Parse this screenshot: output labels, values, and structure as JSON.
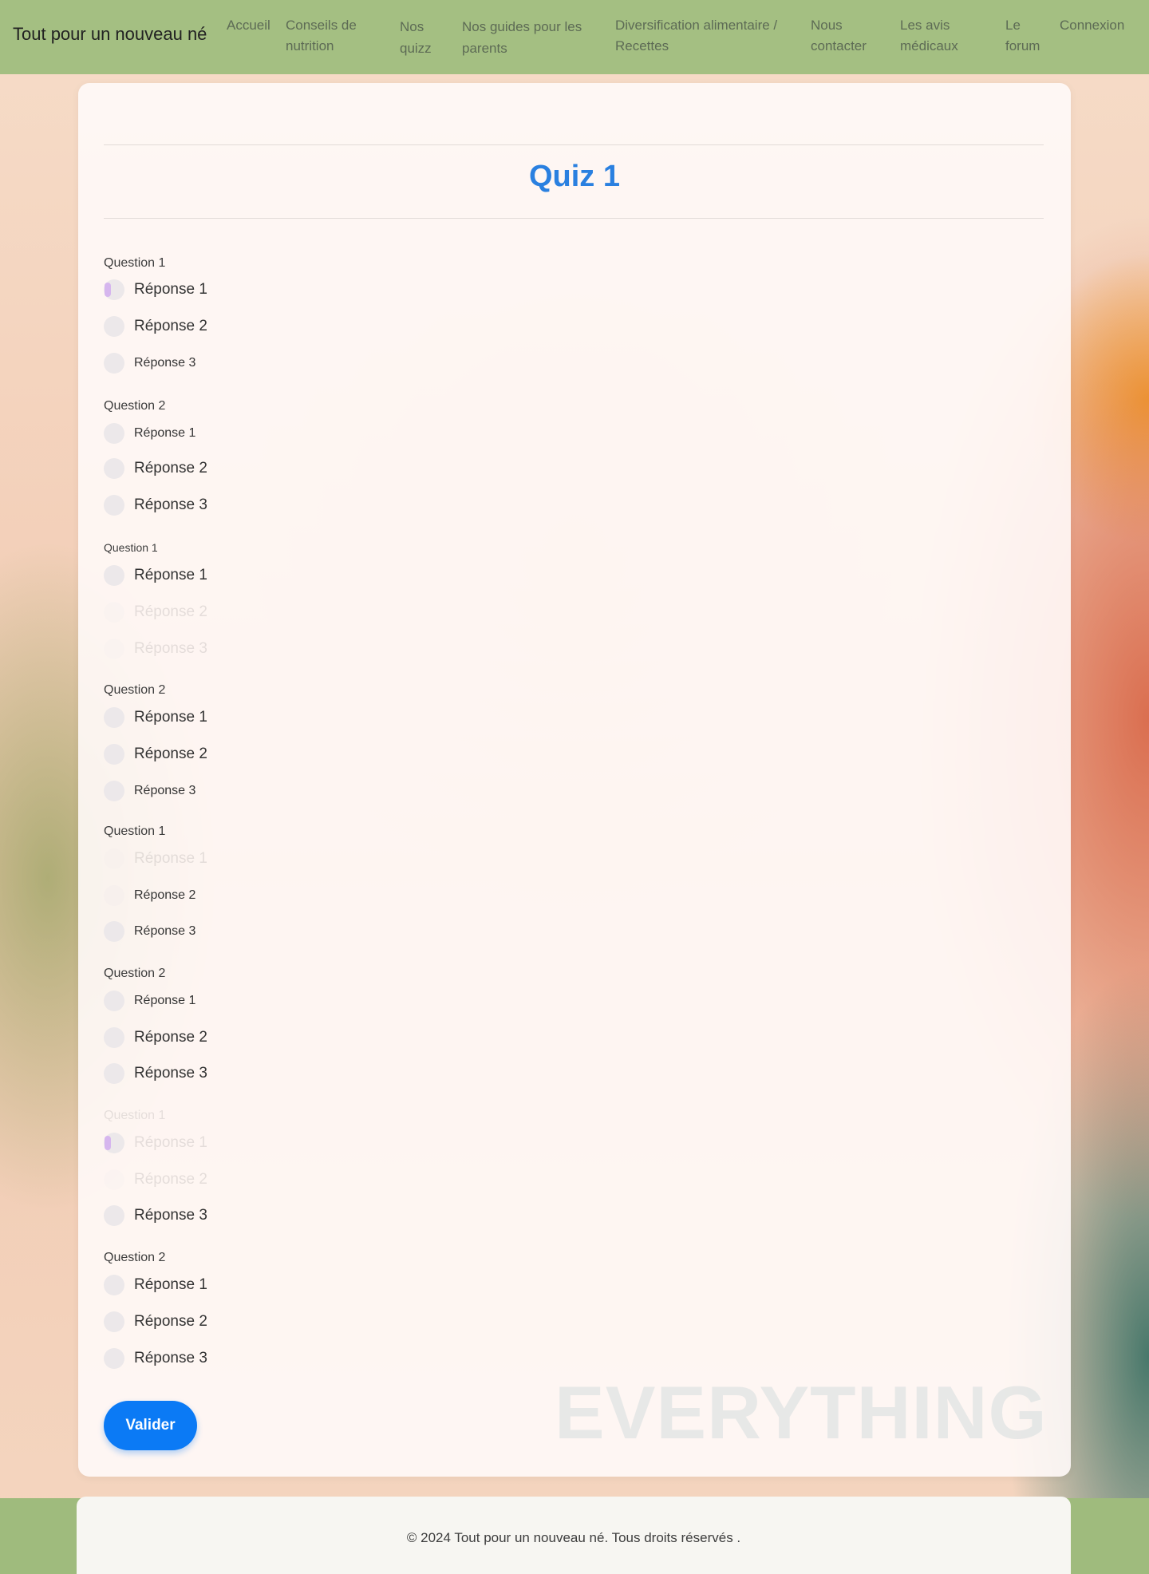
{
  "brand": "Tout pour un nouveau né",
  "nav": [
    {
      "line1": "Accueil",
      "line2": ""
    },
    {
      "line1": "Conseils de",
      "line2": "nutrition"
    },
    {
      "line1": "Nos",
      "line2": "quizz"
    },
    {
      "line1": "Nos guides pour les",
      "line2": "parents"
    },
    {
      "line1": "Diversification alimentaire /",
      "line2": "Recettes"
    },
    {
      "line1": "Nous",
      "line2": "contacter"
    },
    {
      "line1": "Les avis",
      "line2": "médicaux"
    },
    {
      "line1": "Le",
      "line2": "forum"
    },
    {
      "line1": "Connexion",
      "line2": ""
    }
  ],
  "quiz": {
    "title": "Quiz 1",
    "questions": [
      {
        "label": "Question 1",
        "answers": [
          "Réponse 1",
          "Réponse 2",
          "Réponse 3"
        ]
      },
      {
        "label": "Question 2",
        "answers": [
          "Réponse 1",
          "Réponse 2",
          "Réponse 3"
        ]
      },
      {
        "label": "Question 1",
        "answers": [
          "Réponse 1",
          "Réponse 2",
          "Réponse 3"
        ]
      },
      {
        "label": "Question 2",
        "answers": [
          "Réponse 1",
          "Réponse 2",
          "Réponse 3"
        ]
      },
      {
        "label": "Question 1",
        "answers": [
          "Réponse 1",
          "Réponse 2",
          "Réponse 3"
        ]
      },
      {
        "label": "Question 2",
        "answers": [
          "Réponse 1",
          "Réponse 2",
          "Réponse 3"
        ]
      },
      {
        "label": "Question 1",
        "answers": [
          "Réponse 1",
          "Réponse 2",
          "Réponse 3"
        ]
      },
      {
        "label": "Question 2",
        "answers": [
          "Réponse 1",
          "Réponse 2",
          "Réponse 3"
        ]
      }
    ],
    "submit_label": "Valider"
  },
  "background_text": "EVERYTHING",
  "footer": "© 2024 Tout pour un nouveau né. Tous droits réservés ."
}
